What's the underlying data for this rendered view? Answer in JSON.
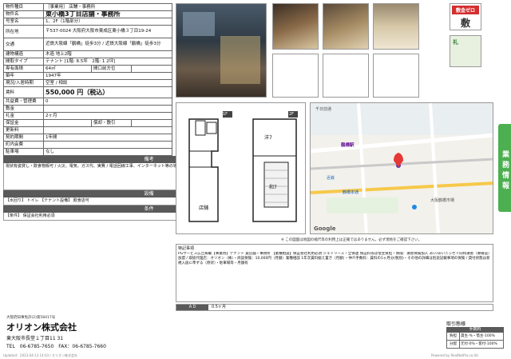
{
  "spec": {
    "rows": [
      {
        "k": "物件種目",
        "v": "［事業用］ 店舗・事務所"
      },
      {
        "k": "物件名",
        "v": "東小橋3丁目店舗・事務所"
      },
      {
        "k": "号室名",
        "v": "1、2F（1階部分）"
      },
      {
        "k": "所在地",
        "v": "〒537-0024 大阪府大阪市東成区東小橋３丁目19-24"
      },
      {
        "k": "交通",
        "v": "近鉄大阪線「鶴橋」徒歩3分 / 近鉄大阪線「鶴橋」徒歩3分"
      },
      {
        "k": "建物構造",
        "v": "木造 地上2階"
      },
      {
        "k": "間取タイプ",
        "v": "テナント [1階: 8.5坪　2階: 1 2坪]"
      },
      {
        "k": "専有面積",
        "v": "64㎡",
        "k2": "間口前方位",
        "v2": ""
      },
      {
        "k": "築年",
        "v": "1947年"
      },
      {
        "k": "現況/入居時期",
        "v": "空室 / 相談"
      },
      {
        "k": "賃料",
        "v": "550,000 円（税込）"
      },
      {
        "k": "共益費・管理費",
        "v": "0"
      },
      {
        "k": "敷金",
        "v": ""
      },
      {
        "k": "礼金",
        "v": "2ヶ月"
      },
      {
        "k": "保証金",
        "v": "",
        "k2": "償却・敷引",
        "v2": ""
      },
      {
        "k": "更新料",
        "v": ""
      },
      {
        "k": "契約期間",
        "v": "1年間"
      },
      {
        "k": "町内会費",
        "v": ""
      },
      {
        "k": "駐車場",
        "v": "なし"
      }
    ],
    "remarks_title": "備考",
    "remarks": "現状有姿貸し・飲食物販可 / 火災、電気、ガス代、実費 / 電話回線工事、インターネット等の導入は借主負担・商品金額負担上げ、消費税 / 敷引等は当該の負担",
    "equip_title": "設備",
    "equip": "【水回り】 トイレ 【テナント設備】 飲食店可",
    "cond_title": "条件",
    "cond": "【条件】 保証会社利用必須"
  },
  "floorplan": {
    "label1": "1F",
    "label2": "2F",
    "shop": "店舗",
    "wa": "洋7",
    "wa2": "和7"
  },
  "map_note": "※ この図面は地図の縮尺等の利用上は正確ではありません。必ず現地をご確認下さい。",
  "map": {
    "labels": [
      "千日前通",
      "鶴橋駅",
      "近鉄",
      "鶴橋本通",
      "大阪鶴橋市場"
    ],
    "google": "Google"
  },
  "special": {
    "title": "特記事項",
    "text": "PGサービス広告掲載【事業用】テナント 貸店舗・事務所 【業種相談】保証会社利用必須 ジェイリース・全保連 保証料等は借主負担・保険：損害保険加入 あい/あいニッセイ同和損害（要確認）加盟 / 取扱代理店：オリオン（株）・商談保険：10,000円（月額）業種相談 1年次賃料据え置き（月額）・仲介手数料：賃料の1ヶ月分(税別)・その他の詳細は別途記載事項の保険 / 貸付状態は新規入居に準ずる（原状）・駐車場等・月額有",
    "ad_label": "ＡＤ",
    "ad_value": "0.5ヶ月"
  },
  "company": {
    "license": "大阪府知事免許(2)第58417号",
    "name": "オリオン株式会社",
    "address": "東大阪市長堂１丁目11 31",
    "tel": "TEL　06-6785-7650　FAX：06-6785-7660"
  },
  "fee": {
    "title": "取引態様",
    "subtitle": "手数料",
    "rows": [
      {
        "k": "負担",
        "v": "貸主-%・借主-100%"
      },
      {
        "k": "分配",
        "v": "元付-0%・客付-100%"
      }
    ]
  },
  "badge": {
    "top": "敷金ゼロ",
    "mid": "敷",
    "bottom": "礼"
  },
  "side_tab": "業務情報",
  "footer_left": "Updated：2023-04-13 14:03 / オリオン株式会社",
  "footer_right": "Powered by RealNetPro.co.ltd"
}
